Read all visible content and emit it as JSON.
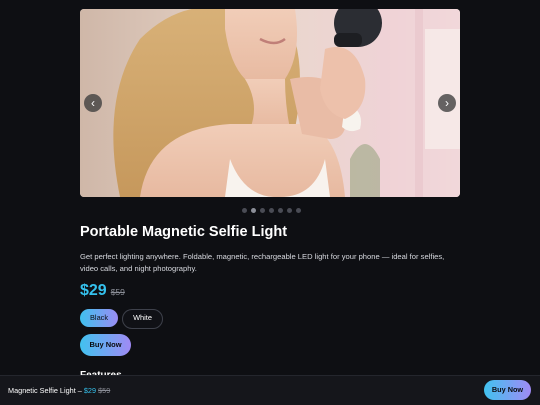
{
  "carousel": {
    "image_alt": "Woman holding a magnetic selfie light",
    "prev_icon": "chevron-left-icon",
    "next_icon": "chevron-right-icon",
    "prev_glyph": "‹",
    "next_glyph": "›",
    "slide_count": 7,
    "active_slide": 2
  },
  "product": {
    "title": "Portable Magnetic Selfie Light",
    "description": "Get perfect lighting anywhere. Foldable, magnetic, rechargeable LED light for your phone — ideal for selfies, video calls, and night photography.",
    "price": "$29",
    "old_price": "$59",
    "colors": [
      "Black",
      "White"
    ],
    "selected_color": "Black",
    "buy_label": "Buy Now",
    "features_heading": "Features"
  },
  "sticky_bar": {
    "name": "Magnetic Selfie Light",
    "separator": " – ",
    "price": "$29",
    "old_price": "$59",
    "buy_label": "Buy Now"
  },
  "colors": {
    "background": "#0e0f13",
    "accent": "#35c2ee",
    "accent_gradient_end": "#a08af5"
  }
}
